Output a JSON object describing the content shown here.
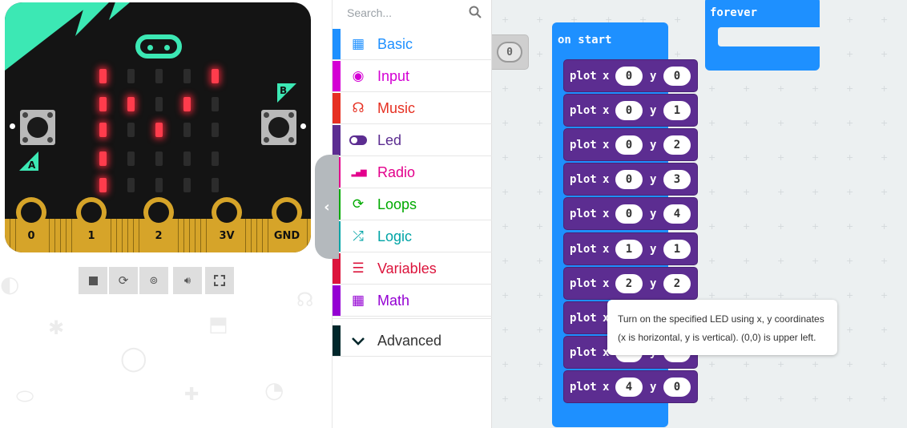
{
  "simulator": {
    "buttons": {
      "a": "A",
      "b": "B"
    },
    "pins": [
      "0",
      "1",
      "2",
      "3V",
      "GND"
    ],
    "led_matrix": [
      [
        1,
        0,
        0,
        0,
        1
      ],
      [
        1,
        1,
        0,
        1,
        0
      ],
      [
        1,
        0,
        1,
        0,
        0
      ],
      [
        1,
        0,
        0,
        0,
        0
      ],
      [
        1,
        0,
        0,
        0,
        0
      ]
    ],
    "controls": [
      "stop-icon",
      "restart-icon",
      "slow-motion-icon",
      "mute-icon",
      "fullscreen-icon"
    ],
    "colors": {
      "board": "#141414",
      "accent": "#3ce8b4",
      "led_on": "#ff3c4c",
      "gold": "#d6a429"
    }
  },
  "toolbox": {
    "search_placeholder": "Search...",
    "categories": [
      {
        "label": "Basic",
        "color": "#1e90ff",
        "icon": "grid-icon"
      },
      {
        "label": "Input",
        "color": "#d400d4",
        "icon": "target-icon"
      },
      {
        "label": "Music",
        "color": "#e63022",
        "icon": "headphones-icon"
      },
      {
        "label": "Led",
        "color": "#5c2d91",
        "icon": "toggle-icon"
      },
      {
        "label": "Radio",
        "color": "#e3008c",
        "icon": "signal-icon"
      },
      {
        "label": "Loops",
        "color": "#00aa00",
        "icon": "refresh-icon"
      },
      {
        "label": "Logic",
        "color": "#00a4a6",
        "icon": "shuffle-icon"
      },
      {
        "label": "Variables",
        "color": "#dc143c",
        "icon": "list-icon"
      },
      {
        "label": "Math",
        "color": "#9400d3",
        "icon": "calculator-icon"
      }
    ],
    "advanced": {
      "label": "Advanced",
      "color": "#00272b"
    }
  },
  "workspace": {
    "stray_value": "0",
    "on_start": {
      "label": "on start"
    },
    "forever": {
      "label": "forever"
    },
    "plot_keyword": "plot",
    "x_label": "x",
    "y_label": "y",
    "plots": [
      {
        "x": "0",
        "y": "0"
      },
      {
        "x": "0",
        "y": "1"
      },
      {
        "x": "0",
        "y": "2"
      },
      {
        "x": "0",
        "y": "3"
      },
      {
        "x": "0",
        "y": "4"
      },
      {
        "x": "1",
        "y": "1"
      },
      {
        "x": "2",
        "y": "2"
      },
      {
        "x": "",
        "y": ""
      },
      {
        "x": "",
        "y": ""
      },
      {
        "x": "4",
        "y": "0"
      }
    ],
    "tooltip": {
      "line1": "Turn on the specified LED using x, y coordinates",
      "line2": "(x is horizontal, y is vertical). (0,0) is upper left."
    }
  }
}
